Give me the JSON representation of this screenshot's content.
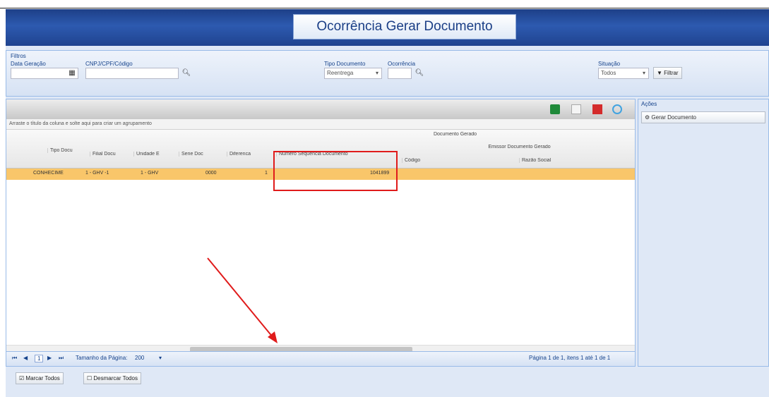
{
  "window": {
    "title": "Ocorrência Gerar Documento"
  },
  "filters": {
    "title": "Filtros",
    "data_geracao_label": "Data Geração",
    "cnpj_label": "CNPJ/CPF/Código",
    "tipo_documento_label": "Tipo Documento",
    "ocorrencia_label": "Ocorrência",
    "tipo_documento_value": "Reentrega",
    "situacao_label": "Situação",
    "situacao_value": "Todos",
    "filter_button": "Filtrar"
  },
  "grid": {
    "group_hint": "Arraste o título da coluna e solte aqui para criar um agrupamento",
    "group_header_doc": "Documento Gerado",
    "group_header_emissor": "Emissor Documento Gerado",
    "columns": {
      "tipo": "Tipo Docu",
      "filial": "Filial Docu",
      "unidade": "Unidade E",
      "serie": "Serie Doc",
      "diferenca": "Diferenca",
      "numero": "Número Sequência Documento",
      "codigo": "Código",
      "razao": "Razão Social"
    },
    "row": {
      "tipo": "CONHECIME",
      "filial": "1 - GHV -1",
      "unidade": "1 - GHV",
      "serie": "0000",
      "diferenca": "1",
      "numero": "1041899"
    }
  },
  "pager": {
    "current_page": "1",
    "page_size_label": "Tamanho da Página:",
    "page_size_value": "200",
    "summary": "Página 1 de 1, itens 1 até 1 de 1"
  },
  "bottom": {
    "mark_all": "Marcar Todos",
    "unmark_all": "Desmarcar Todos"
  },
  "actions": {
    "title": "Ações",
    "generate_button": "Gerar Documento"
  }
}
